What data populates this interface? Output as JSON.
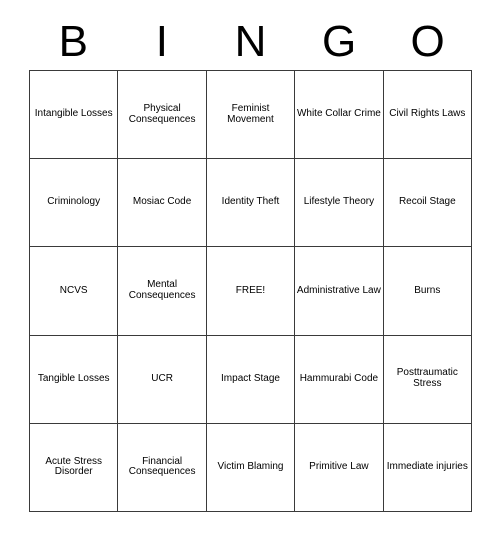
{
  "card": {
    "header_letters": [
      "B",
      "I",
      "N",
      "G",
      "O"
    ],
    "free_space_label": "FREE!",
    "rows": [
      [
        {
          "text": "Intangible Losses"
        },
        {
          "text": "Physical Consequences"
        },
        {
          "text": "Feminist Movement"
        },
        {
          "text": "White Collar Crime"
        },
        {
          "text": "Civil Rights Laws"
        }
      ],
      [
        {
          "text": "Criminology"
        },
        {
          "text": "Mosiac Code"
        },
        {
          "text": "Identity Theft"
        },
        {
          "text": "Lifestyle Theory"
        },
        {
          "text": "Recoil Stage"
        }
      ],
      [
        {
          "text": "NCVS"
        },
        {
          "text": "Mental Consequences"
        },
        {
          "text": "FREE!"
        },
        {
          "text": "Administrative Law"
        },
        {
          "text": "Burns"
        }
      ],
      [
        {
          "text": "Tangible Losses"
        },
        {
          "text": "UCR"
        },
        {
          "text": "Impact Stage"
        },
        {
          "text": "Hammurabi Code"
        },
        {
          "text": "Posttraumatic Stress"
        }
      ],
      [
        {
          "text": "Acute Stress Disorder"
        },
        {
          "text": "Financial Consequences"
        },
        {
          "text": "Victim Blaming"
        },
        {
          "text": "Primitive Law"
        },
        {
          "text": "Immediate injuries"
        }
      ]
    ]
  },
  "colors": {
    "border": "#3a3a3a",
    "text": "#000000",
    "background": "#ffffff"
  }
}
